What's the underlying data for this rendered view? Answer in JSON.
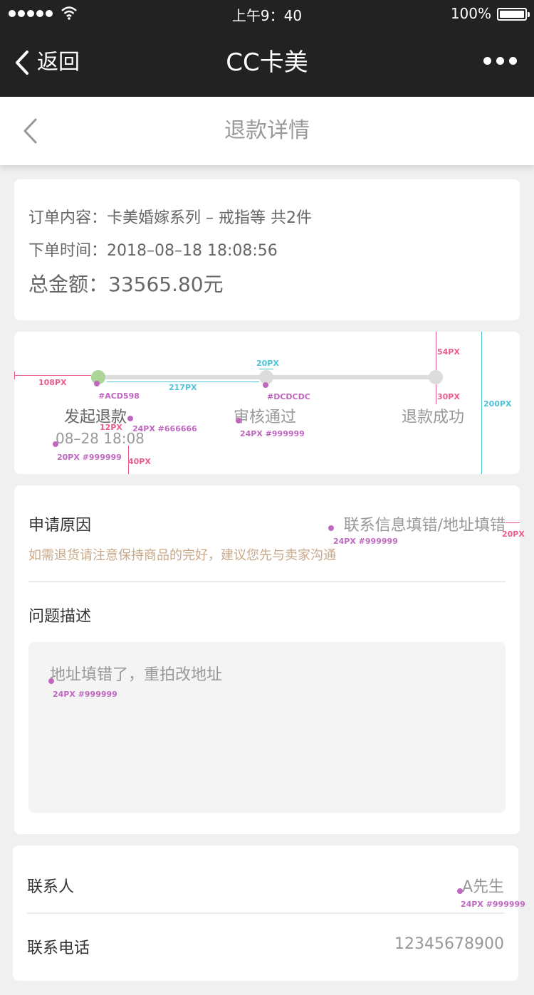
{
  "status_bar": {
    "time": "上午9：40",
    "battery": "100%"
  },
  "nav": {
    "back": "返回",
    "title": "CC卡美"
  },
  "page": {
    "title": "退款详情"
  },
  "order": {
    "content_label": "订单内容：",
    "content_value": "卡美婚嫁系列 – 戒指等 共2件",
    "time_label": "下单时间：",
    "time_value": "2018–08–18 18:08:56",
    "total_label": "总金额：",
    "total_value": "33565.80元"
  },
  "progress": {
    "steps": [
      {
        "label": "发起退款",
        "time": "08–28 18:08",
        "state": "done"
      },
      {
        "label": "审核通过",
        "state": "pending"
      },
      {
        "label": "退款成功",
        "state": "pending"
      }
    ],
    "colors": {
      "done": "#ACD598",
      "pending": "#DCDCDC"
    }
  },
  "annotations": {
    "a108": "108PX",
    "a217": "217PX",
    "a20_top": "20PX",
    "a54": "54PX",
    "a30": "30PX",
    "a200": "200PX",
    "c_done": "#ACD598",
    "c_pending": "#DCDCDC",
    "a12": "12PX",
    "a24_666": "24PX #666666",
    "a24_999_step": "24PX #999999",
    "a20_999": "20PX #999999",
    "a40": "40PX",
    "a24_999_reason": "24PX #999999",
    "a20_right": "20PX",
    "a24_999_desc": "24PX #999999",
    "a24_999_contact": "24PX #999999"
  },
  "reason": {
    "label": "申请原因",
    "value": "联系信息填错/地址填错",
    "hint": "如需退货请注意保持商品的完好，建议您先与卖家沟通"
  },
  "description": {
    "label": "问题描述",
    "text": "地址填错了，重拍改地址"
  },
  "contact": {
    "name_label": "联系人",
    "name_value": "A先生",
    "phone_label": "联系电话",
    "phone_value": "12345678900"
  }
}
